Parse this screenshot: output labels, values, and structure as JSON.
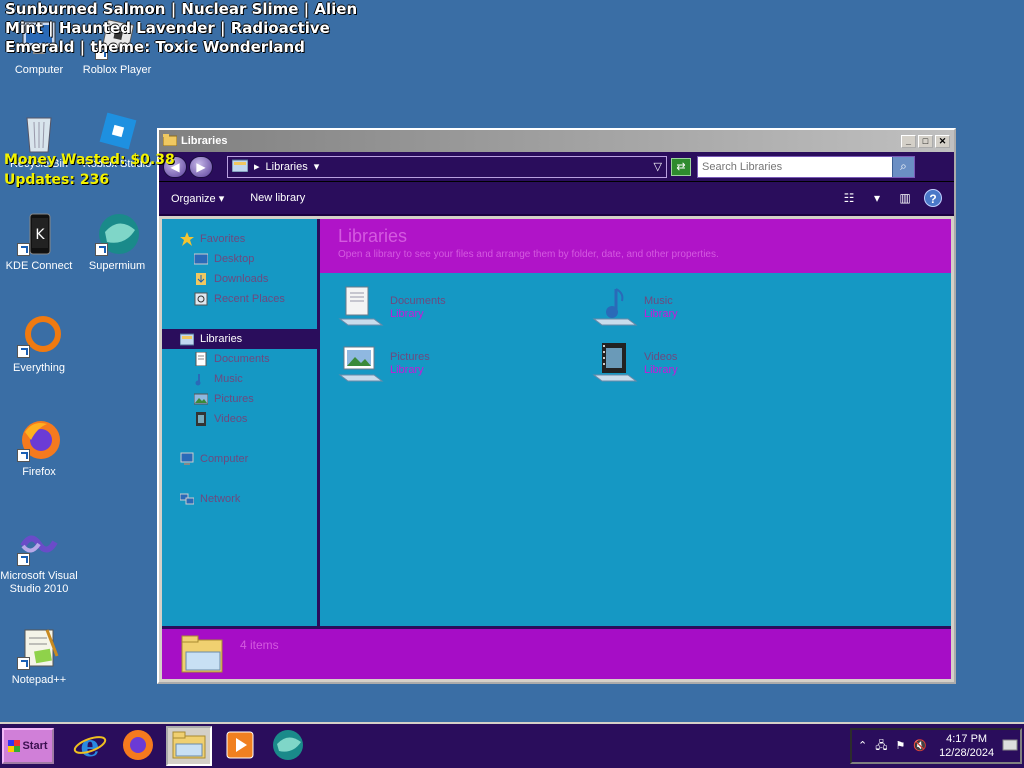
{
  "overlay": {
    "theme_line": "Sunburned Salmon | Nuclear Slime | Alien Mint | Haunted Lavender | Radioactive Emerald | theme: Toxic Wonderland",
    "money": "Money Wasted: $0.38",
    "updates": "Updates: 236"
  },
  "desktop": {
    "icons": [
      {
        "label": "Computer",
        "icon": "computer-icon"
      },
      {
        "label": "Roblox Player",
        "icon": "roblox-player-icon"
      },
      {
        "label": "Recycle Bin",
        "icon": "recycle-bin-icon"
      },
      {
        "label": "Roblox Studio",
        "icon": "roblox-studio-icon"
      },
      {
        "label": "KDE Connect",
        "icon": "kde-connect-icon"
      },
      {
        "label": "Supermium",
        "icon": "supermium-icon"
      },
      {
        "label": "Everything",
        "icon": "everything-icon"
      },
      {
        "label": "Firefox",
        "icon": "firefox-icon"
      },
      {
        "label": "Microsoft Visual Studio 2010",
        "icon": "visual-studio-icon"
      },
      {
        "label": "Notepad++",
        "icon": "notepad-plus-plus-icon"
      }
    ]
  },
  "window": {
    "title": "Libraries",
    "address": {
      "path_label": "Libraries"
    },
    "search": {
      "placeholder": "Search Libraries"
    },
    "toolbar": {
      "organize": "Organize",
      "new_library": "New library"
    },
    "nav": {
      "favorites": "Favorites",
      "desktop": "Desktop",
      "downloads": "Downloads",
      "recent_places": "Recent Places",
      "libraries": "Libraries",
      "documents": "Documents",
      "music": "Music",
      "pictures": "Pictures",
      "videos": "Videos",
      "computer": "Computer",
      "network": "Network"
    },
    "banner": {
      "title": "Libraries",
      "subtitle": "Open a library to see your files and arrange them by folder, date, and other properties."
    },
    "libraries": [
      {
        "name": "Documents",
        "type": "Library",
        "icon": "documents-library-icon"
      },
      {
        "name": "Music",
        "type": "Library",
        "icon": "music-library-icon"
      },
      {
        "name": "Pictures",
        "type": "Library",
        "icon": "pictures-library-icon"
      },
      {
        "name": "Videos",
        "type": "Library",
        "icon": "videos-library-icon"
      }
    ],
    "status": {
      "count": "4 items"
    }
  },
  "taskbar": {
    "start_label": "Start",
    "time": "4:17 PM",
    "date": "12/28/2024"
  },
  "colors": {
    "desktop": "#3a6ea5",
    "chrome": "#2a0d5c",
    "pane": "#1598c4",
    "banner": "#b014c8",
    "accent_text": "#d45ae0"
  }
}
